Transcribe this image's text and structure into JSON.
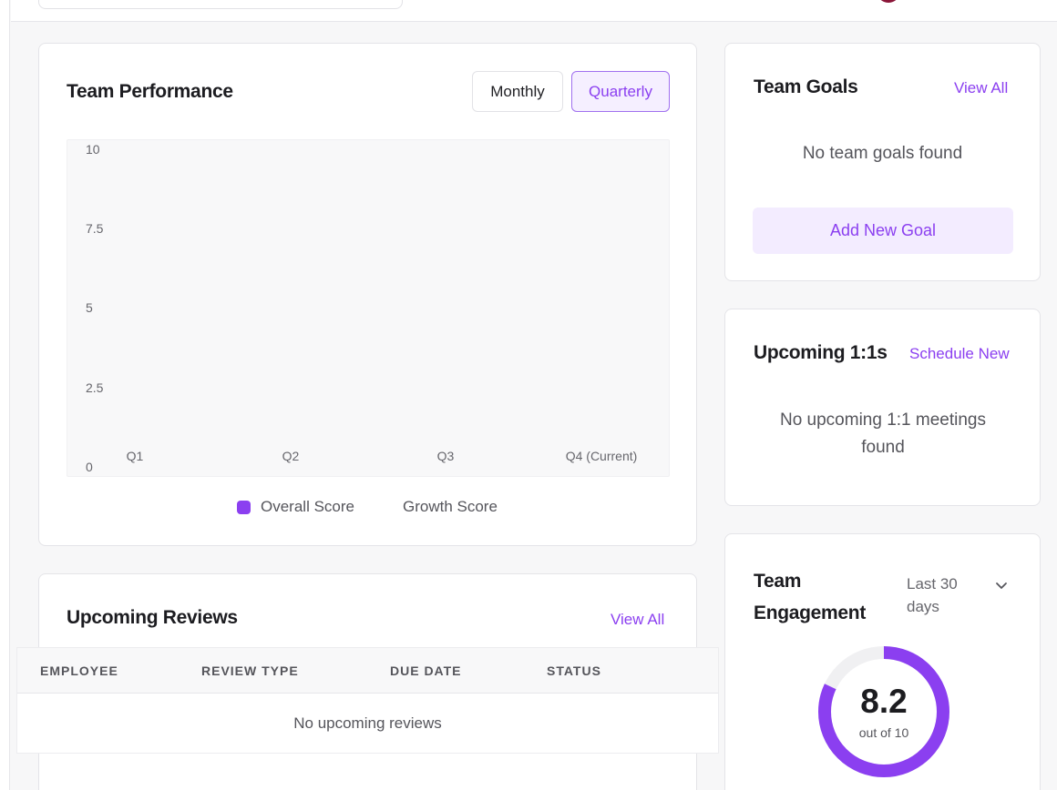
{
  "performance": {
    "title": "Team Performance",
    "monthly_label": "Monthly",
    "quarterly_label": "Quarterly",
    "active_period": "Quarterly"
  },
  "chart_data": {
    "type": "bar",
    "categories": [
      "Q1",
      "Q2",
      "Q3",
      "Q4 (Current)"
    ],
    "yticks": [
      "10",
      "7.5",
      "5",
      "2.5",
      "0"
    ],
    "ylim": [
      0,
      10
    ],
    "series": [
      {
        "name": "Overall Score",
        "values": [],
        "color": "#8b3ff0"
      },
      {
        "name": "Growth Score",
        "values": []
      }
    ],
    "grid": false,
    "legend": "bottom-center"
  },
  "goals": {
    "title": "Team Goals",
    "view_all": "View All",
    "empty": "No team goals found",
    "add_button": "Add New Goal"
  },
  "one_on_ones": {
    "title": "Upcoming 1:1s",
    "schedule": "Schedule New",
    "empty": "No upcoming 1:1 meetings found"
  },
  "reviews": {
    "title": "Upcoming Reviews",
    "view_all": "View All",
    "columns": [
      "EMPLOYEE",
      "REVIEW TYPE",
      "DUE DATE",
      "STATUS"
    ],
    "empty": "No upcoming reviews"
  },
  "engagement": {
    "title_line1": "Team",
    "title_line2": "Engagement",
    "range_line1": "Last 30",
    "range_line2": "days",
    "score": "8.2",
    "score_sub": "out of 10",
    "score_fraction": 0.82
  },
  "colors": {
    "accent": "#8b3ff0",
    "accent_soft": "#f3ecff"
  }
}
